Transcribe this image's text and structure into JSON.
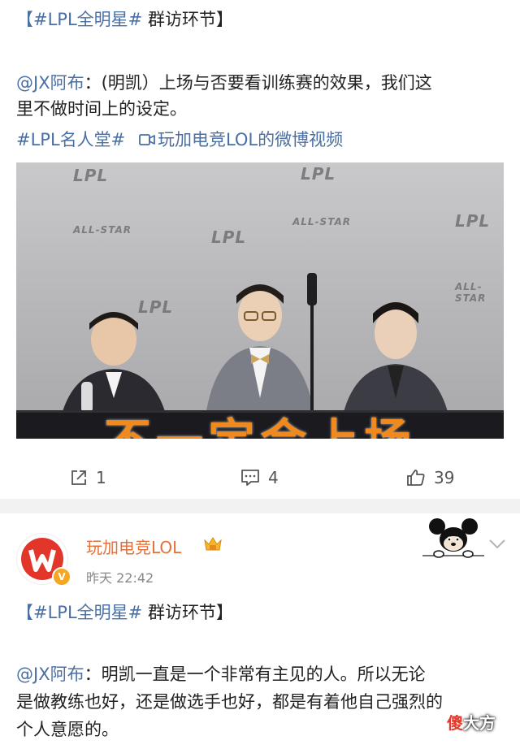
{
  "post1": {
    "topic_hashtag": "【#LPL全明星#",
    "topic_suffix": " 群访环节】",
    "mention": "@JX阿布",
    "quote": "：(明凯）上场与否要看训练赛的效果，我们这",
    "quote_line2": "里不做时间上的设定。",
    "hashtag2": "#LPL名人堂#",
    "video_link": "玩加电竞LOL的微博视频",
    "image_caption": "不一定会上场",
    "logo_text": "LPL",
    "logo_allstar": "ALL-STAR",
    "actions": {
      "share_count": "1",
      "comment_count": "4",
      "like_count": "39"
    }
  },
  "post2": {
    "username": "玩加电竞LOL",
    "timestamp": "昨天 22:42",
    "topic_hashtag": "【#LPL全明星#",
    "topic_suffix": " 群访环节】",
    "mention": "@JX阿布",
    "quote": "：明凯一直是一个非常有主见的人。所以无论",
    "quote_line2": "是做教练也好，还是做选手也好，都是有着他自己强烈的",
    "quote_line3": "个人意愿的。"
  },
  "watermark": {
    "red_char": "傻",
    "rest": "大方"
  },
  "colors": {
    "link": "#4a6fa5",
    "username": "#e2703a",
    "caption": "#f0891e"
  },
  "icons": [
    "share-icon",
    "comment-icon",
    "like-icon",
    "video-icon",
    "vip-crown-icon",
    "chevron-down-icon",
    "verified-badge-icon"
  ]
}
